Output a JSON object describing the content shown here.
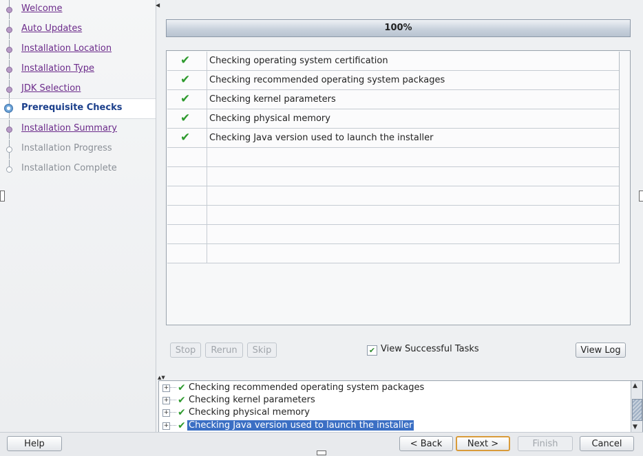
{
  "sidebar": {
    "steps": [
      {
        "label": "Welcome",
        "state": "done"
      },
      {
        "label": "Auto Updates",
        "state": "done"
      },
      {
        "label": "Installation Location",
        "state": "done"
      },
      {
        "label": "Installation Type",
        "state": "done"
      },
      {
        "label": "JDK Selection",
        "state": "done"
      },
      {
        "label": "Prerequisite Checks",
        "state": "current"
      },
      {
        "label": "Installation Summary",
        "state": "done"
      },
      {
        "label": "Installation Progress",
        "state": "pending"
      },
      {
        "label": "Installation Complete",
        "state": "pending"
      }
    ]
  },
  "progress": {
    "text": "100%",
    "value": 1.0
  },
  "checks": {
    "rows": [
      {
        "status": "passed",
        "label": "Checking operating system certification"
      },
      {
        "status": "passed",
        "label": "Checking recommended operating system packages"
      },
      {
        "status": "passed",
        "label": "Checking kernel parameters"
      },
      {
        "status": "passed",
        "label": "Checking physical memory"
      },
      {
        "status": "passed",
        "label": "Checking Java version used to launch the installer"
      }
    ],
    "empty_rows": 6
  },
  "actions": {
    "stop": "Stop",
    "rerun": "Rerun",
    "skip": "Skip",
    "view_successful_tasks": "View Successful Tasks",
    "view_successful_checked": true,
    "view_log": "View Log"
  },
  "log": {
    "lines": [
      {
        "label": "Checking recommended operating system packages",
        "selected": false
      },
      {
        "label": "Checking kernel parameters",
        "selected": false
      },
      {
        "label": "Checking physical memory",
        "selected": false
      },
      {
        "label": "Checking Java version used to launch the installer",
        "selected": true
      }
    ]
  },
  "footer": {
    "help": "Help",
    "back": "< Back",
    "next": "Next >",
    "finish": "Finish",
    "cancel": "Cancel"
  },
  "icons": {
    "check": "check-icon",
    "expand": "expand-icon"
  },
  "colors": {
    "accent": "#3b6fc4",
    "success": "#2e9a2e",
    "link": "#6b2a8a",
    "current_step": "#1b3f8b"
  }
}
